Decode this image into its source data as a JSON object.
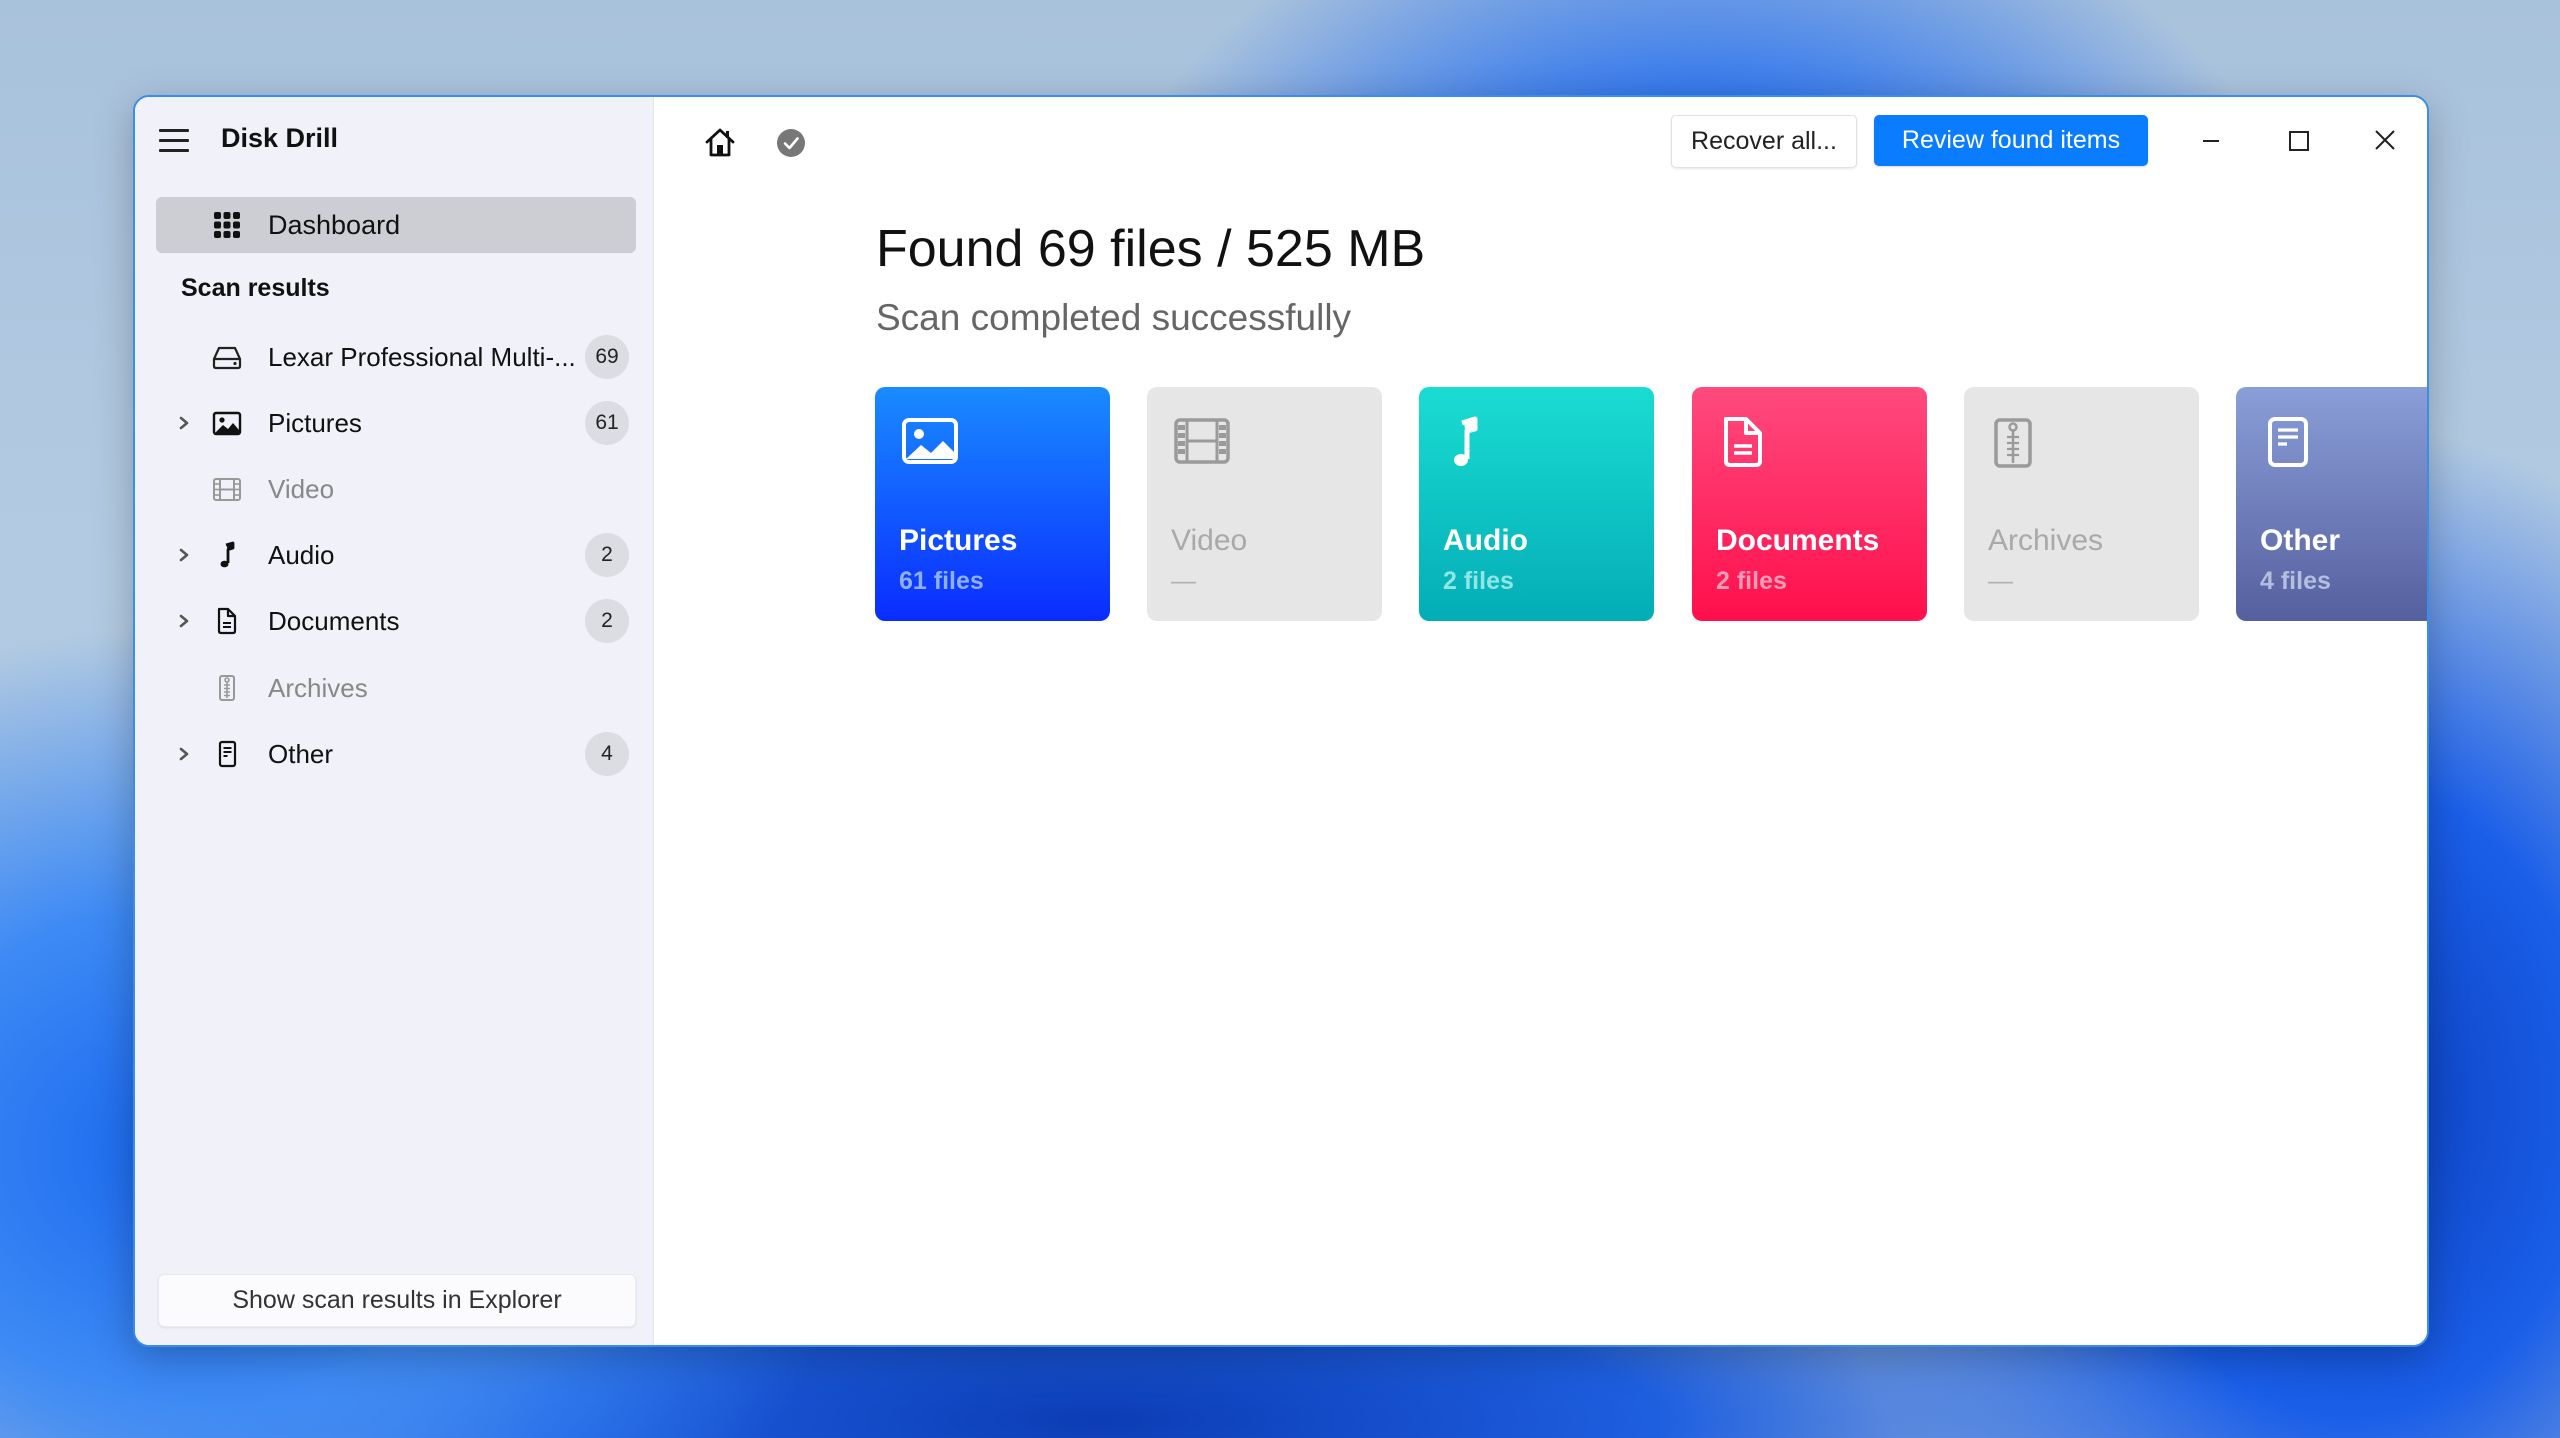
{
  "app": {
    "title": "Disk Drill"
  },
  "sidebar": {
    "dashboard_label": "Dashboard",
    "section_label": "Scan results",
    "items": [
      {
        "label": "Lexar Professional Multi-...",
        "count": "69",
        "icon": "drive-icon",
        "expandable": false,
        "enabled": true
      },
      {
        "label": "Pictures",
        "count": "61",
        "icon": "picture-icon",
        "expandable": true,
        "enabled": true
      },
      {
        "label": "Video",
        "count": null,
        "icon": "film-icon",
        "expandable": false,
        "enabled": false
      },
      {
        "label": "Audio",
        "count": "2",
        "icon": "music-note-icon",
        "expandable": true,
        "enabled": true
      },
      {
        "label": "Documents",
        "count": "2",
        "icon": "document-icon",
        "expandable": true,
        "enabled": true
      },
      {
        "label": "Archives",
        "count": null,
        "icon": "archive-zip-icon",
        "expandable": false,
        "enabled": false
      },
      {
        "label": "Other",
        "count": "4",
        "icon": "other-file-icon",
        "expandable": true,
        "enabled": true
      }
    ],
    "footer_button": "Show scan results in Explorer"
  },
  "toolbar": {
    "recover_all_label": "Recover all...",
    "review_label": "Review found items",
    "accent_color": "#0a7cff"
  },
  "summary": {
    "headline": "Found 69 files / 525 MB",
    "status": "Scan completed successfully"
  },
  "categories": [
    {
      "name": "Pictures",
      "sub": "61 files",
      "icon": "picture-icon",
      "enabled": true,
      "color_top": "#1a8bff",
      "color_bottom": "#0a2cff",
      "sub_color": "#8fb0ff"
    },
    {
      "name": "Video",
      "sub": "—",
      "icon": "film-icon",
      "enabled": false,
      "color_top": "#e6e6e6",
      "color_bottom": "#e6e6e6",
      "sub_color": "#b0b0b0"
    },
    {
      "name": "Audio",
      "sub": "2 files",
      "icon": "music-note-icon",
      "enabled": true,
      "color_top": "#1adcd2",
      "color_bottom": "#03adb6",
      "sub_color": "#8fe6e4"
    },
    {
      "name": "Documents",
      "sub": "2 files",
      "icon": "document-icon",
      "enabled": true,
      "color_top": "#ff4a7e",
      "color_bottom": "#ff0f4c",
      "sub_color": "#ff9cb6"
    },
    {
      "name": "Archives",
      "sub": "—",
      "icon": "archive-zip-icon",
      "enabled": false,
      "color_top": "#e6e6e6",
      "color_bottom": "#e6e6e6",
      "sub_color": "#b0b0b0"
    },
    {
      "name": "Other",
      "sub": "4 files",
      "icon": "other-file-icon",
      "enabled": true,
      "color_top": "#8a9ed8",
      "color_bottom": "#55609e",
      "sub_color": "#b5bde0"
    }
  ]
}
